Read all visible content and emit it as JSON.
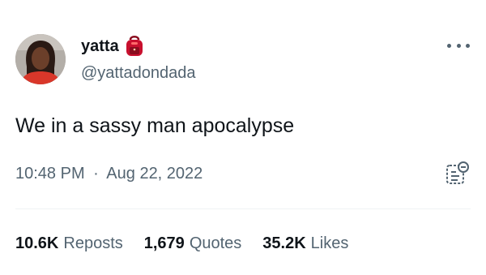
{
  "user": {
    "display_name": "yatta",
    "handle": "@yattadondada",
    "name_emoji": "red-backpack-emoji"
  },
  "tweet": {
    "text": "We in a sassy man apocalypse",
    "time": "10:48 PM",
    "separator": "·",
    "date": "Aug 22, 2022"
  },
  "stats": [
    {
      "count": "10.6K",
      "label": "Reposts"
    },
    {
      "count": "1,679",
      "label": "Quotes"
    },
    {
      "count": "35.2K",
      "label": "Likes"
    }
  ],
  "icons": {
    "more": "more-horizontal-icon",
    "analytics": "view-analytics-icon"
  },
  "colors": {
    "primary_text": "#0f1419",
    "secondary_text": "#536471",
    "divider": "#eff3f4",
    "emoji_red": "#c8102e"
  }
}
